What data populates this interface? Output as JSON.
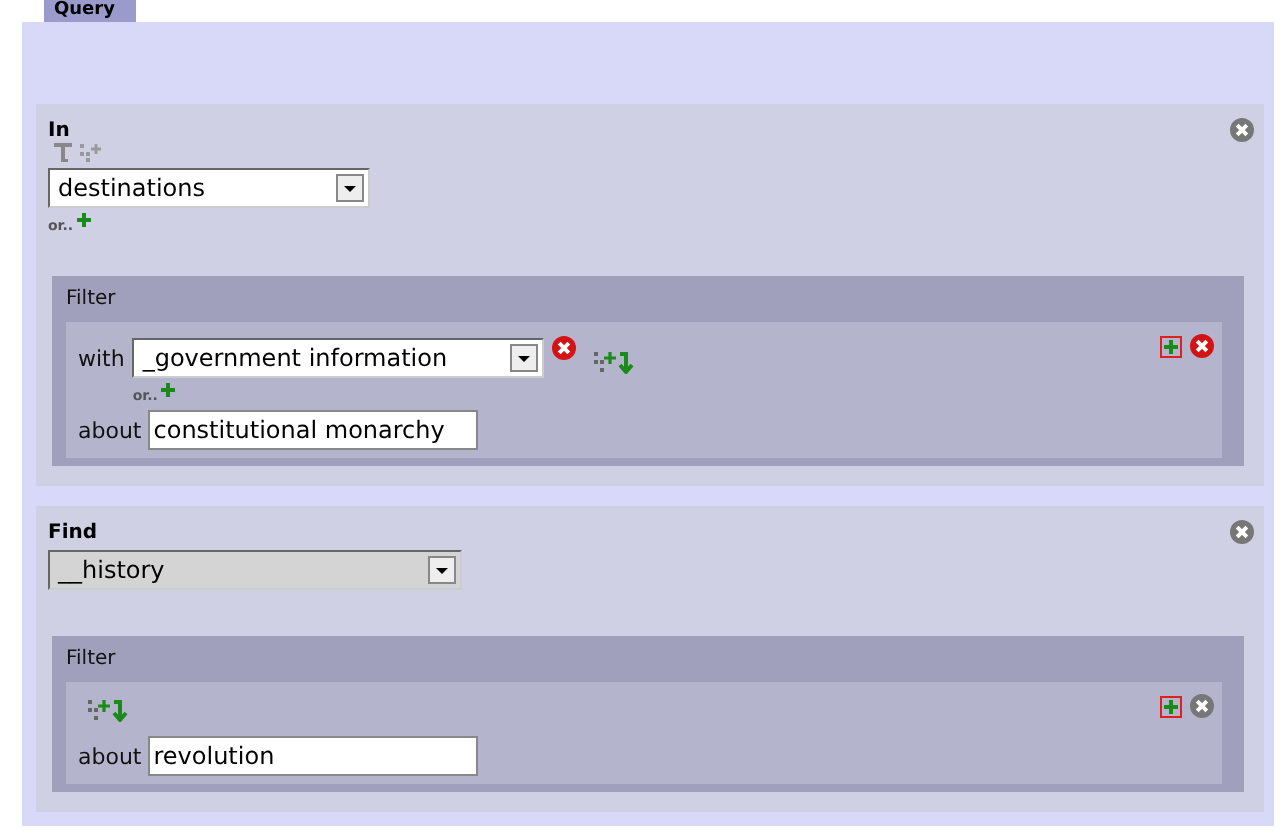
{
  "tab": {
    "label": "Query",
    "selected": true
  },
  "sections": [
    {
      "title": "In",
      "tools": true,
      "select": {
        "value": "destinations",
        "disabled": false
      },
      "or_label": "or..",
      "filter": {
        "title": "Filter",
        "active": true,
        "with": {
          "label": "with",
          "value": "_government information",
          "or_label": "or.."
        },
        "about": {
          "label": "about",
          "value": "constitutional monarchy"
        }
      }
    },
    {
      "title": "Find",
      "tools": false,
      "select": {
        "value": "__history",
        "disabled": true
      },
      "filter": {
        "title": "Filter",
        "active": false,
        "about": {
          "label": "about",
          "value": "revolution"
        }
      }
    }
  ]
}
